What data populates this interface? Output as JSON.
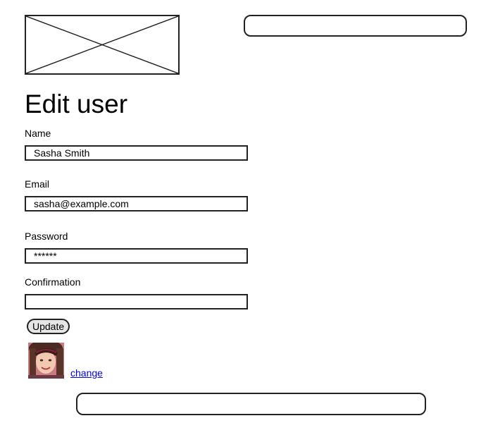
{
  "header": {
    "logo_icon": "image-placeholder-icon",
    "search_bar_value": ""
  },
  "page_title": "Edit user",
  "form": {
    "name_label": "Name",
    "name_value": "Sasha Smith",
    "email_label": "Email",
    "email_value": "sasha@example.com",
    "password_label": "Password",
    "password_value": "******",
    "confirmation_label": "Confirmation",
    "confirmation_value": "",
    "update_label": "Update"
  },
  "avatar": {
    "icon": "user-avatar-photo",
    "change_label": "change"
  },
  "footer": {
    "bar_value": ""
  },
  "colors": {
    "border": "#222222",
    "button_bg": "#e6e6e6",
    "link": "#0000ee",
    "avatar_bg": "#c97a82"
  }
}
